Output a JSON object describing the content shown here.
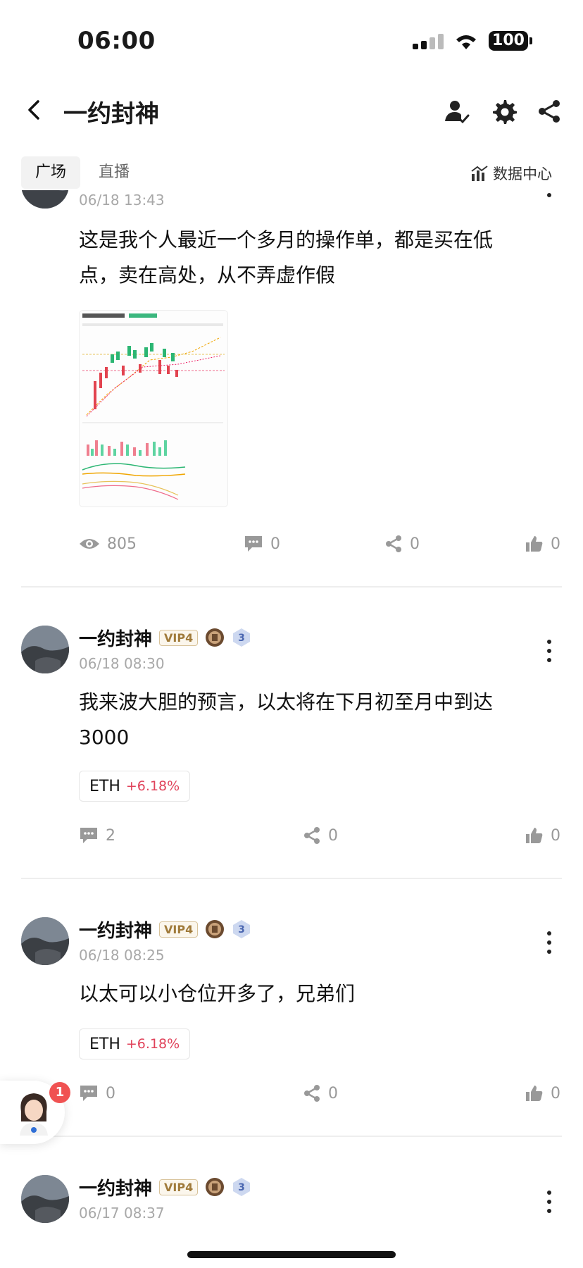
{
  "status_bar": {
    "time": "06:00",
    "battery": "100"
  },
  "header": {
    "title": "一约封神"
  },
  "tabs": {
    "active": "广场",
    "second": "直播",
    "data_center": "数据中心"
  },
  "posts": [
    {
      "timestamp": "06/18 13:43",
      "content": "这是我个人最近一个多月的操作单，都是买在低点，卖在高处，从不弄虚作假",
      "views": "805",
      "comments": "0",
      "shares": "0",
      "likes": "0"
    },
    {
      "username": "一约封神",
      "vip": "VIP4",
      "level": "3",
      "timestamp": "06/18 08:30",
      "content": "我来波大胆的预言，以太将在下月初至月中到达3000",
      "tag_symbol": "ETH",
      "tag_change": "+6.18%",
      "comments": "2",
      "shares": "0",
      "likes": "0"
    },
    {
      "username": "一约封神",
      "vip": "VIP4",
      "level": "3",
      "timestamp": "06/18 08:25",
      "content": "以太可以小仓位开多了，兄弟们",
      "tag_symbol": "ETH",
      "tag_change": "+6.18%",
      "comments": "0",
      "shares": "0",
      "likes": "0"
    },
    {
      "username": "一约封神",
      "vip": "VIP4",
      "level": "3",
      "timestamp": "06/17 08:37"
    }
  ],
  "assistant": {
    "badge_count": "1"
  },
  "colors": {
    "accent_red": "#e0425a",
    "muted": "#999999"
  }
}
